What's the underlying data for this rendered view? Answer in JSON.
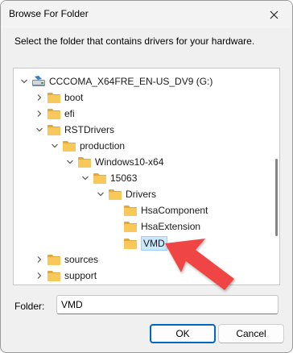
{
  "window": {
    "title": "Browse For Folder"
  },
  "instruction": "Select the folder that contains drivers for your hardware.",
  "tree": [
    {
      "label": "CCCOMA_X64FRE_EN-US_DV9 (G:)",
      "icon": "drive-icon",
      "chevron": "expanded"
    },
    {
      "label": "boot",
      "icon": "folder-icon",
      "chevron": "collapsed"
    },
    {
      "label": "efi",
      "icon": "folder-icon",
      "chevron": "collapsed"
    },
    {
      "label": "RSTDrivers",
      "icon": "folder-icon",
      "chevron": "expanded"
    },
    {
      "label": "production",
      "icon": "folder-icon",
      "chevron": "expanded"
    },
    {
      "label": "Windows10-x64",
      "icon": "folder-icon",
      "chevron": "expanded"
    },
    {
      "label": "15063",
      "icon": "folder-icon",
      "chevron": "expanded"
    },
    {
      "label": "Drivers",
      "icon": "folder-icon",
      "chevron": "expanded"
    },
    {
      "label": "HsaComponent",
      "icon": "folder-icon",
      "chevron": "none"
    },
    {
      "label": "HsaExtension",
      "icon": "folder-icon",
      "chevron": "none"
    },
    {
      "label": "VMD",
      "icon": "folder-icon",
      "chevron": "none",
      "selected": true
    },
    {
      "label": "sources",
      "icon": "folder-icon",
      "chevron": "collapsed"
    },
    {
      "label": "support",
      "icon": "folder-icon",
      "chevron": "collapsed"
    }
  ],
  "folder": {
    "label": "Folder:",
    "value": "VMD"
  },
  "buttons": {
    "ok": "OK",
    "cancel": "Cancel"
  },
  "colors": {
    "accent": "#0067c0",
    "selection": "#cce8ff",
    "folder": "#f8c85a",
    "arrow": "#ef4444"
  }
}
